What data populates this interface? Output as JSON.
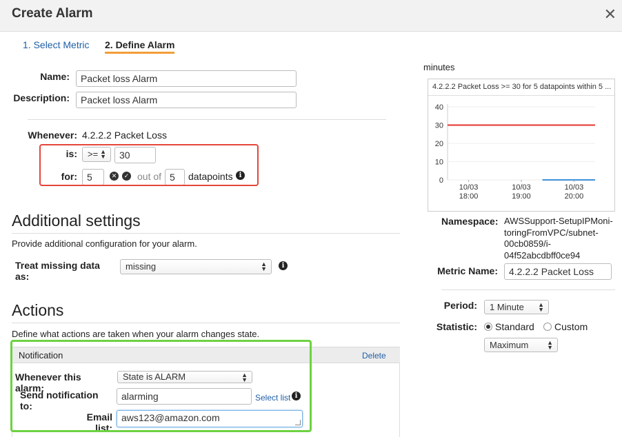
{
  "dialog": {
    "title": "Create Alarm",
    "close_glyph": "✕"
  },
  "steps": {
    "step1": "1. Select Metric",
    "step2": "2. Define Alarm"
  },
  "alarm": {
    "name_label": "Name:",
    "name_value": "Packet loss Alarm",
    "description_label": "Description:",
    "description_value": "Packet loss Alarm",
    "whenever_label": "Whenever:",
    "whenever_value": "4.2.2.2 Packet Loss",
    "is_label": "is:",
    "operator": ">=",
    "threshold": "30",
    "for_label": "for:",
    "datapoints_count": "5",
    "out_of": "out of",
    "datapoints_total": "5",
    "datapoints_label": "datapoints"
  },
  "additional": {
    "heading": "Additional settings",
    "description": "Provide additional configuration for your alarm.",
    "missing_label": "Treat missing data as:",
    "missing_value": "missing"
  },
  "actions": {
    "heading": "Actions",
    "description": "Define what actions are taken when your alarm changes state.",
    "notification_title": "Notification",
    "delete_label": "Delete",
    "whenever_label": "Whenever this alarm:",
    "whenever_value": "State is ALARM",
    "send_label": "Send notification to:",
    "send_value": "alarming",
    "select_list": "Select list",
    "email_label": "Email list:",
    "email_value": "aws123@amazon.com"
  },
  "preview": {
    "minutes_label": "minutes",
    "namespace_label": "Namespace:",
    "namespace_lines": [
      "AWSSupport-SetupIPMoni-",
      "toringFromVPC/subnet-",
      "00cb0859/i-",
      "04f52abcdbff0ce94"
    ],
    "metric_label": "Metric Name:",
    "metric_value": "4.2.2.2 Packet Loss",
    "period_label": "Period:",
    "period_value": "1 Minute",
    "statistic_label": "Statistic:",
    "statistic_standard": "Standard",
    "statistic_custom": "Custom",
    "statistic_selected": "Standard",
    "statistic_value": "Maximum"
  },
  "colors": {
    "threshold": "#e5322d",
    "series": "#3e8fd8",
    "alarm_highlight": "#e5453a",
    "actions_highlight": "#6cd240",
    "tab_underline": "#f29d38"
  },
  "chart_data": {
    "type": "line",
    "title": "4.2.2.2 Packet Loss >= 30 for 5 datapoints within 5 ...",
    "ylim": [
      0,
      40
    ],
    "yticks": [
      "40",
      "30",
      "20",
      "10",
      "0"
    ],
    "xtick_labels": [
      [
        "10/03",
        "18:00"
      ],
      [
        "10/03",
        "19:00"
      ],
      [
        "10/03",
        "20:00"
      ]
    ],
    "threshold": 30,
    "series": [
      {
        "x": [
          19.4,
          20.4
        ],
        "values": [
          0,
          0
        ]
      }
    ],
    "xlim": [
      17.6,
      20.4
    ],
    "xticks": [
      18,
      19,
      20
    ]
  }
}
